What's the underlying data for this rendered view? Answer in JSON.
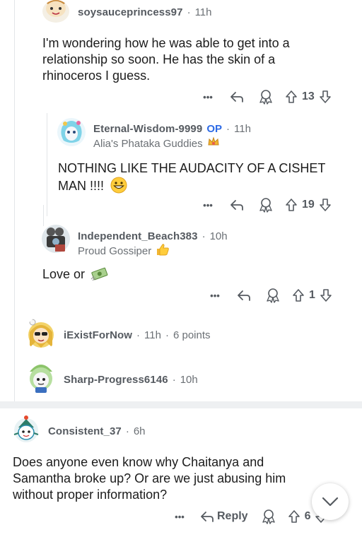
{
  "comments": [
    {
      "username": "soysauceprincess97",
      "time": "11h",
      "text": "I'm wondering how he was able to get into a relationship so soon. He has the skin of a rhinoceros I guess.",
      "votes": "13",
      "more": "•••"
    },
    {
      "username": "Eternal-Wisdom-9999",
      "op": "OP",
      "time": "11h",
      "flair": "Alia's Phataka Guddies",
      "text": "NOTHING LIKE THE AUDACITY OF A CISHET MAN !!!!",
      "votes": "19",
      "more": "•••"
    },
    {
      "username": "Independent_Beach383",
      "time": "10h",
      "flair": "Proud Gossiper",
      "text": "Love or",
      "votes": "1",
      "more": "•••"
    },
    {
      "username": "iExistForNow",
      "time": "11h",
      "points": "6 points"
    },
    {
      "username": "Sharp-Progress6146",
      "time": "10h"
    },
    {
      "username": "Consistent_37",
      "time": "6h",
      "text": "Does anyone even know why Chaitanya and Samantha broke up? Or are we just abusing him without proper information?",
      "reply_label": "Reply",
      "votes": "6",
      "more": "•••"
    }
  ],
  "separator": "·",
  "colors": {
    "op_blue": "#2e6be6",
    "meta_gray": "#6b7075",
    "divider": "#eef0f2"
  },
  "icons": [
    "reply-icon",
    "award-icon",
    "upvote-icon",
    "downvote-icon",
    "more-icon",
    "chevron-down-icon",
    "emoji-grin",
    "emoji-thumbs-up",
    "emoji-money",
    "emoji-crown"
  ]
}
